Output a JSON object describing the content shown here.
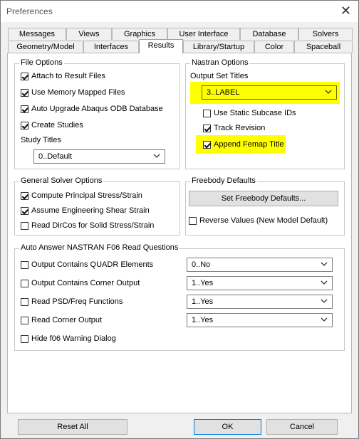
{
  "window": {
    "title": "Preferences",
    "close": "✕"
  },
  "tabs": {
    "row1": [
      "Messages",
      "Views",
      "Graphics",
      "User Interface",
      "Database",
      "Solvers"
    ],
    "row2": [
      "Geometry/Model",
      "Interfaces",
      "Results",
      "Library/Startup",
      "Color",
      "Spaceball"
    ],
    "active": "Results"
  },
  "file_options": {
    "title": "File Options",
    "items": [
      {
        "label": "Attach to Result Files",
        "checked": true
      },
      {
        "label": "Use Memory Mapped Files",
        "checked": true
      },
      {
        "label": "Auto Upgrade Abaqus ODB Database",
        "checked": true
      },
      {
        "label": "Create Studies",
        "checked": true
      }
    ],
    "study_titles_label": "Study Titles",
    "study_titles_value": "0..Default"
  },
  "nastran_options": {
    "title": "Nastran Options",
    "output_set_titles_label": "Output Set Titles",
    "output_set_titles_value": "3..LABEL",
    "items": [
      {
        "label": "Use Static Subcase IDs",
        "checked": false
      },
      {
        "label": "Track Revision",
        "checked": true
      },
      {
        "label": "Append Femap Title",
        "checked": true
      }
    ]
  },
  "general_solver": {
    "title": "General Solver Options",
    "items": [
      {
        "label": "Compute Principal Stress/Strain",
        "checked": true
      },
      {
        "label": "Assume Engineering Shear Strain",
        "checked": true
      },
      {
        "label": "Read DirCos for Solid Stress/Strain",
        "checked": false
      }
    ]
  },
  "freebody": {
    "title": "Freebody Defaults",
    "button": "Set Freebody Defaults...",
    "reverse_label": "Reverse Values (New Model Default)",
    "reverse_checked": false
  },
  "auto_answer": {
    "title": "Auto Answer NASTRAN F06 Read Questions",
    "rows": [
      {
        "label": "Output Contains QUADR Elements",
        "checked": false,
        "value": "0..No"
      },
      {
        "label": "Output Contains Corner Output",
        "checked": false,
        "value": "1..Yes"
      },
      {
        "label": "Read PSD/Freq Functions",
        "checked": false,
        "value": "1..Yes"
      },
      {
        "label": "Read Corner Output",
        "checked": false,
        "value": "1..Yes"
      }
    ],
    "hide_label": "Hide f06 Warning Dialog",
    "hide_checked": false
  },
  "footer": {
    "reset": "Reset All",
    "ok": "OK",
    "cancel": "Cancel"
  },
  "colors": {
    "highlight": "#ffff00"
  }
}
